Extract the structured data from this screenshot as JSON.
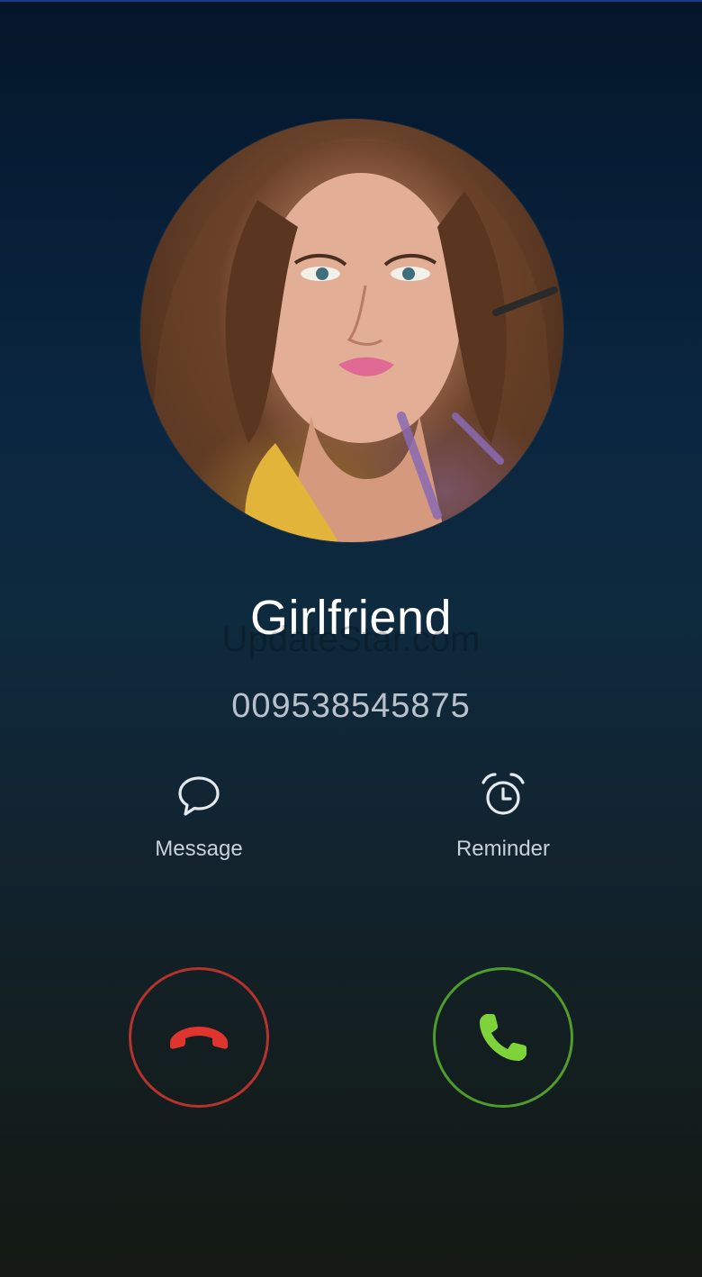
{
  "caller": {
    "name": "Girlfriend",
    "number": "009538545875"
  },
  "watermark": "UpdateStar.com",
  "actions": {
    "message_label": "Message",
    "reminder_label": "Reminder"
  },
  "icons": {
    "message": "chat-bubble-icon",
    "reminder": "alarm-clock-icon",
    "decline": "phone-hangup-icon",
    "answer": "phone-icon"
  },
  "colors": {
    "decline": "#e0352e",
    "answer": "#7ed23a",
    "decline_ring": "#b6322c",
    "answer_ring": "#4f9b2c"
  }
}
